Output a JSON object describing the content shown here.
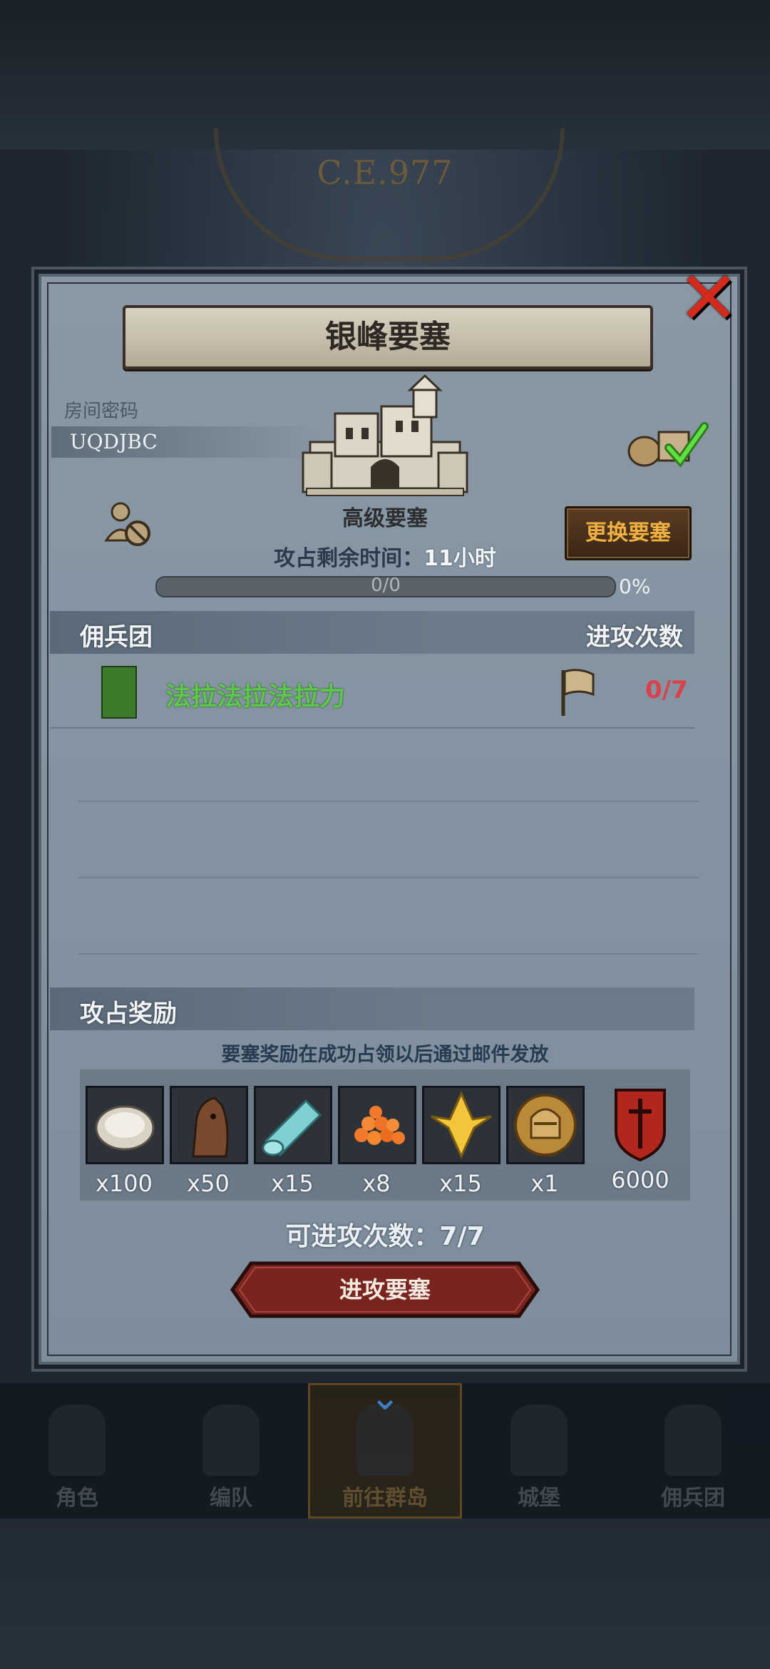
{
  "header": {
    "era_label": "C.E.977"
  },
  "dialog": {
    "title": "银峰要塞",
    "room": {
      "label": "房间密码",
      "code": "UQDJBC"
    },
    "fortress_level": "高级要塞",
    "change_button": "更换要塞",
    "time_label": "攻占剩余时间：",
    "time_value": "11小时",
    "progress": {
      "count": "0/0",
      "percent_text": "0%",
      "fraction": 0
    },
    "mercenary": {
      "header": "佣兵团",
      "attacks_header": "进攻次数",
      "rows": [
        {
          "name": "法拉法拉法拉力",
          "attacks": "0/7"
        }
      ]
    },
    "rewards": {
      "header": "攻占奖励",
      "note": "要塞奖励在成功占领以后通过邮件发放",
      "items": [
        {
          "icon": "oyster-icon",
          "qty": "x100"
        },
        {
          "icon": "horse-icon",
          "qty": "x50"
        },
        {
          "icon": "cloth-icon",
          "qty": "x15"
        },
        {
          "icon": "roe-icon",
          "qty": "x8"
        },
        {
          "icon": "gold-crest-icon",
          "qty": "x15"
        },
        {
          "icon": "knight-medal-icon",
          "qty": "x1"
        },
        {
          "icon": "shield-emblem-icon",
          "qty": "6000"
        }
      ]
    },
    "attacks_left_label": "可进攻次数：",
    "attacks_left_value": "7/7",
    "attack_button": "进攻要塞"
  },
  "nav": {
    "items": [
      {
        "label": "角色"
      },
      {
        "label": "编队"
      },
      {
        "label": "前往群岛"
      },
      {
        "label": "城堡"
      },
      {
        "label": "佣兵团"
      }
    ]
  },
  "colors": {
    "accent_gold": "#f0b142",
    "merc_name": "#5cc84b",
    "attacks_red": "#d9424a",
    "close_red": "#d42a1d",
    "attack_button": "#7a2420"
  }
}
